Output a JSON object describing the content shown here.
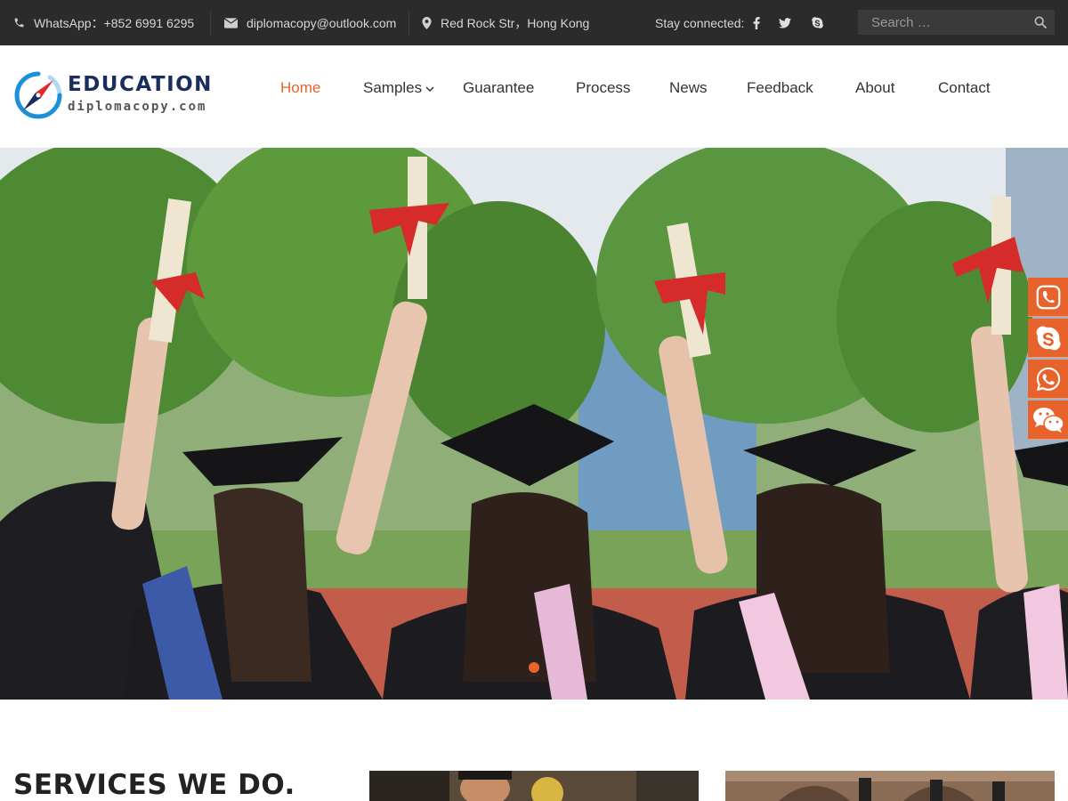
{
  "topbar": {
    "phone_label": "WhatsApp：+852 6991 6295",
    "email_label": "diplomacopy@outlook.com",
    "address_label": "Red Rock Str，Hong Kong",
    "stay_connected": "Stay connected:",
    "social_icons": [
      "facebook-icon",
      "twitter-icon",
      "skype-icon"
    ],
    "search_placeholder": "Search …"
  },
  "logo": {
    "title": "EDUCATION",
    "subtitle": "diplomacopy.com"
  },
  "nav": {
    "items": [
      {
        "label": "Home",
        "active": true
      },
      {
        "label": "Samples",
        "has_dropdown": true
      },
      {
        "label": "Guarantee"
      },
      {
        "label": "Process"
      },
      {
        "label": "News"
      },
      {
        "label": "Feedback"
      },
      {
        "label": "About"
      },
      {
        "label": "Contact"
      }
    ]
  },
  "hero": {
    "slides_count": 1,
    "active_slide": 1
  },
  "side_contacts": [
    "phone-icon",
    "skype-icon",
    "whatsapp-icon",
    "wechat-icon"
  ],
  "services": {
    "title": "SERVICES WE DO."
  },
  "colors": {
    "accent": "#e8632b",
    "topbar_bg": "#2b2b2b",
    "logo_navy": "#1a2e5e",
    "logo_blue": "#1e90d8"
  }
}
